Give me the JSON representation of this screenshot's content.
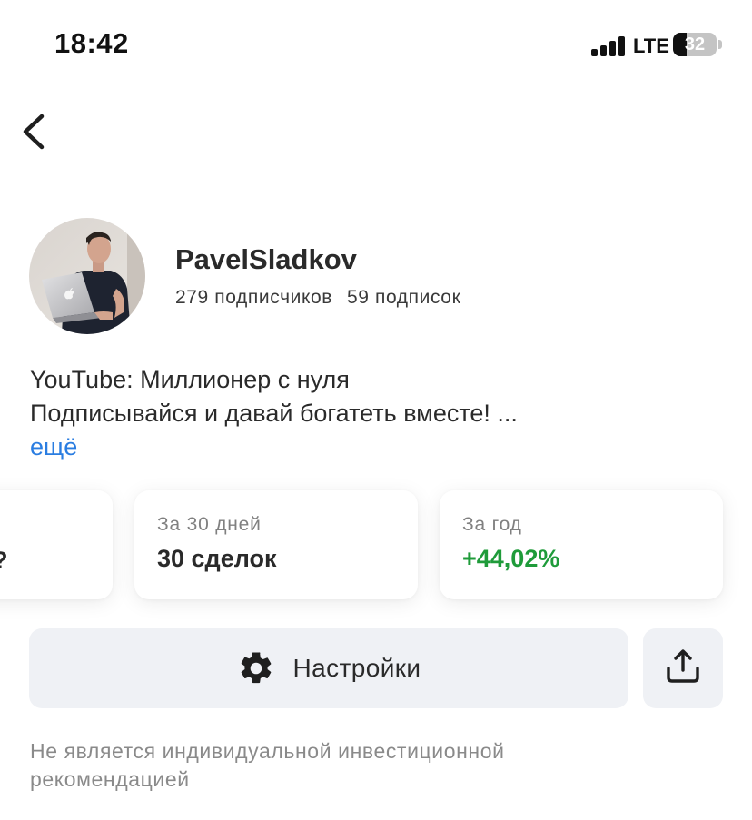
{
  "status_bar": {
    "time": "18:42",
    "network": "LTE",
    "battery": "32",
    "battery_level": 0.32
  },
  "navigation": {
    "back_icon": "chevron-left-icon"
  },
  "profile": {
    "name": "PavelSladkov",
    "followers": "279 подписчиков",
    "following": "59 подписок",
    "avatar_icon": "avatar-photo"
  },
  "bio": {
    "line1": "YouTube: Миллионер с нуля",
    "line2": "Подписывайся и давай богатеть вместе! ...",
    "more_link": "ещё"
  },
  "stats": {
    "partial_card": {
      "value_glyph": "?"
    },
    "cards": [
      {
        "label": "За 30 дней",
        "value": "30 сделок",
        "positive": false
      },
      {
        "label": "За год",
        "value": "+44,02%",
        "positive": true
      }
    ],
    "positive_color": "#1f9b3a"
  },
  "actions": {
    "settings_label": "Настройки",
    "settings_icon": "gear-icon",
    "share_icon": "share-icon"
  },
  "disclaimer": "Не является индивидуальной инвестиционной рекомендацией",
  "colors": {
    "link": "#2a7de1",
    "button_bg": "#eff1f5",
    "muted_text": "#8a8a8a"
  }
}
